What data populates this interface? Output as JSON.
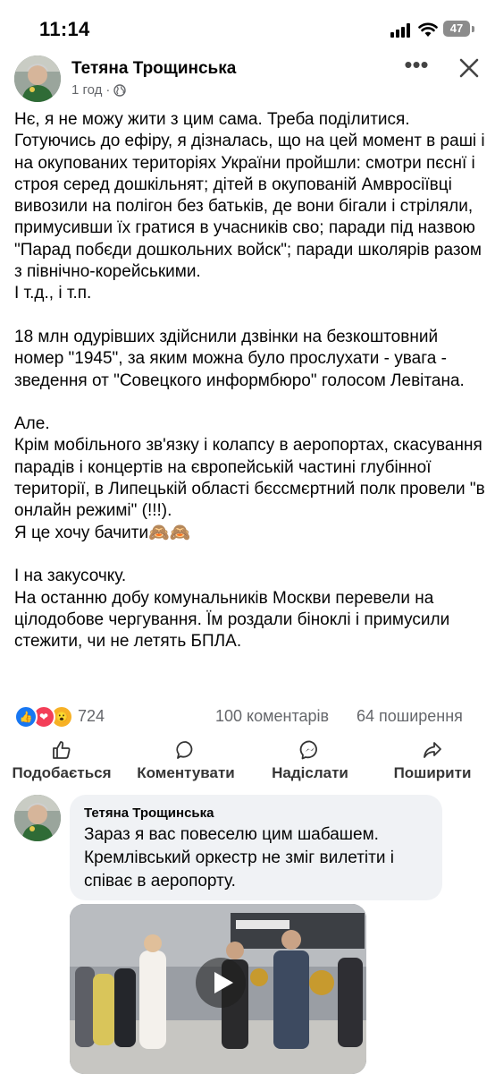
{
  "status_bar": {
    "time": "11:14",
    "battery": "47"
  },
  "post": {
    "author": "Тетяна Трощинська",
    "time_ago": "1 год",
    "paragraphs": [
      "Нє, я не можу жити з цим сама. Треба поділитися.\nГотуючись до ефіру, я дізналась, що на цей момент в раші і на окупованих територіях України пройшли: смотри пєснї і строя серед дошкільнят; дітей в окупованій Амвросіївці вивозили на полігон без батьків, де вони бігали і стріляли, примусивши їх гратися в учасників сво; паради під назвою \"Парад побєди дошкольних войск\"; паради школярів разом з північно-корейськими.\nІ т.д., і т.п.",
      "18 млн одурівших здійснили дзвінки на безкоштовний номер \"1945\", за яким можна було прослухати - увага - зведення от \"Совецкого информбюро\" голосом Левітана.",
      "Але.\nКрім мобільного зв'язку і колапсу в аеропортах, скасування парадів і концертів на європейській частині  глубінної території, в Липецькій області бєссмєртний полк провели \"в онлайн режимі\" (!!!).\nЯ це хочу бачити🙈🙈",
      "І на закусочку.\nНа останню добу комунальників Москви перевели на цілодобове чергування. Їм роздали біноклі і примусили стежити, чи не летять БПЛА."
    ],
    "reactions_count": "724",
    "comments_count": "100 коментарів",
    "shares_count": "64 поширення"
  },
  "actions": {
    "like": "Подобається",
    "comment": "Коментувати",
    "send": "Надіслати",
    "share": "Поширити"
  },
  "comment": {
    "author": "Тетяна Трощинська",
    "text": "Зараз я вас повеселю цим шабашем. Кремлівський оркестр не зміг вилетіти і співає в аеропорту."
  },
  "colors": {
    "like_blue": "#1877f2",
    "love_red": "#f33e58",
    "wow_yellow": "#f7b125",
    "secondary_text": "#65676b",
    "bubble_bg": "#f0f2f5"
  }
}
